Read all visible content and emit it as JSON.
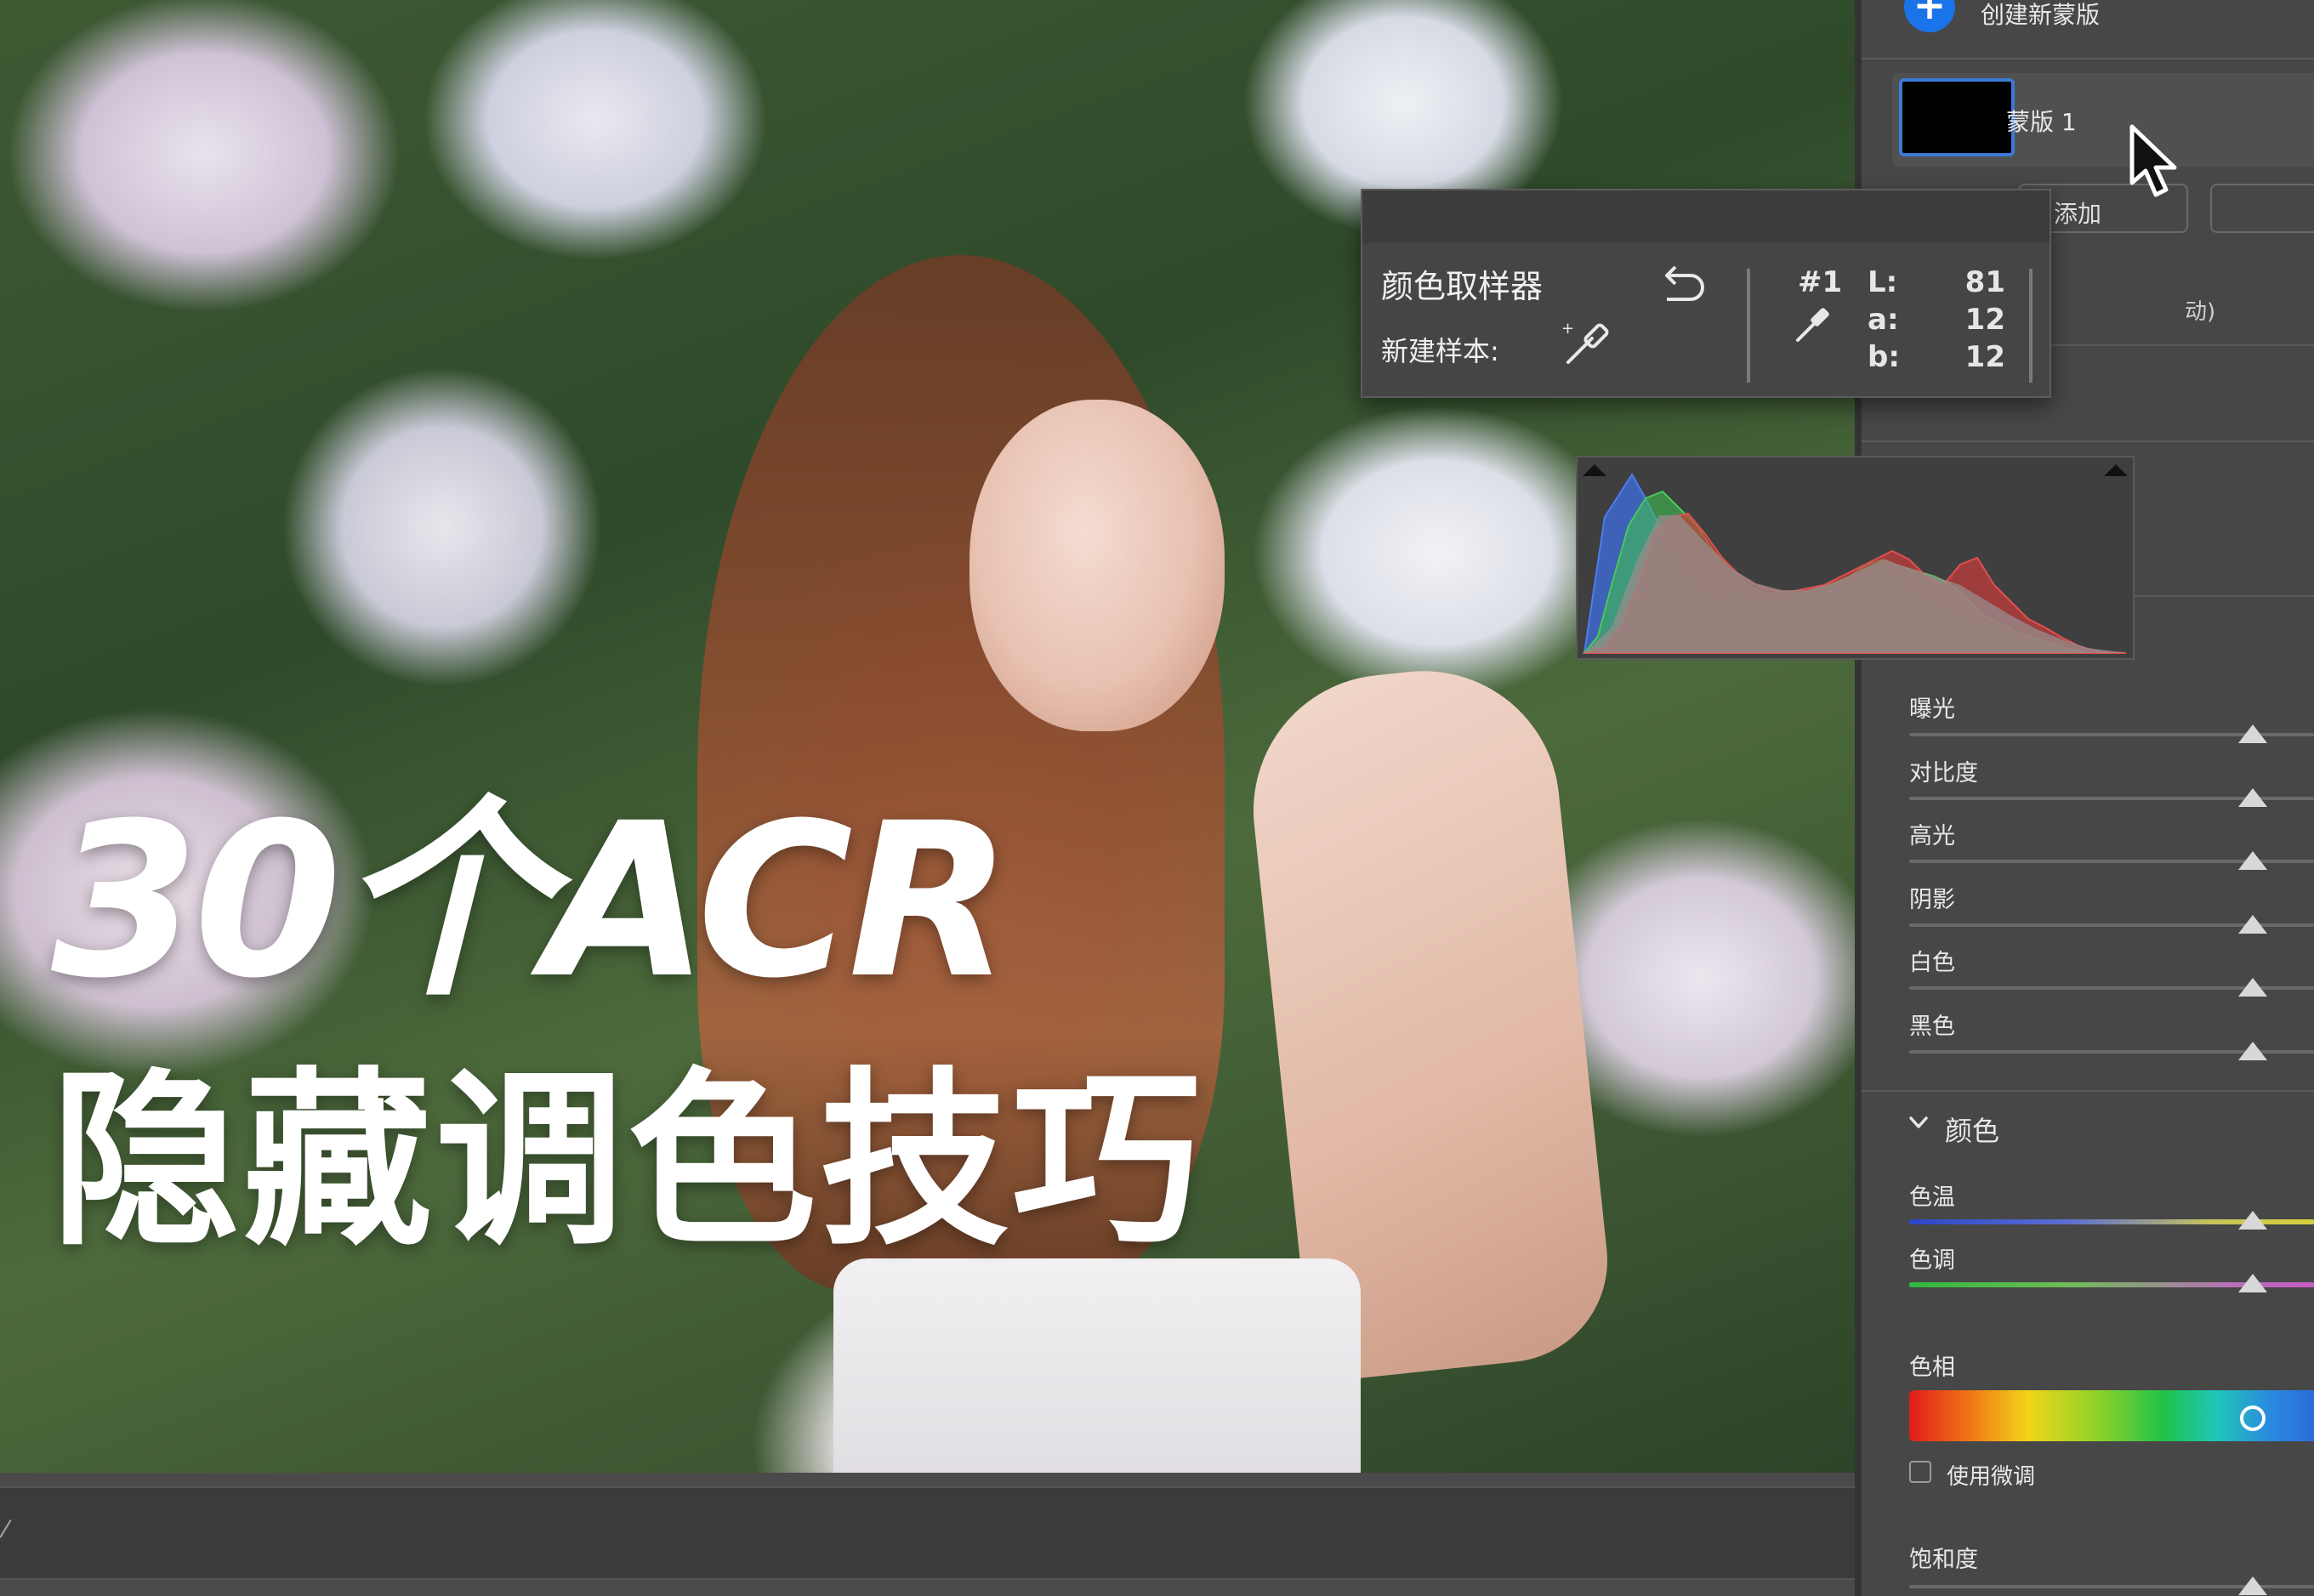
{
  "headline": {
    "line1": "30个ACR",
    "line2": "隐藏调色技巧"
  },
  "mask_panel": {
    "create_new_mask": "创建新蒙版",
    "mask_name": "蒙版 1",
    "add_button": "添加",
    "auto_suffix": "动)"
  },
  "color_sampler": {
    "title": "颜色取样器",
    "new_sample_label": "新建样本:",
    "sample_id": "#1",
    "lab": [
      {
        "key": "L:",
        "value": "81"
      },
      {
        "key": "a:",
        "value": "12"
      },
      {
        "key": "b:",
        "value": "12"
      }
    ]
  },
  "light_sliders": [
    {
      "label": "曝光",
      "value_fraction": 0.5
    },
    {
      "label": "对比度",
      "value_fraction": 0.5
    },
    {
      "label": "高光",
      "value_fraction": 0.5
    },
    {
      "label": "阴影",
      "value_fraction": 0.5
    },
    {
      "label": "白色",
      "value_fraction": 0.5
    },
    {
      "label": "黑色",
      "value_fraction": 0.5
    }
  ],
  "color_section": {
    "header": "颜色",
    "temperature": {
      "label": "色温",
      "value_fraction": 0.5
    },
    "tint": {
      "label": "色调",
      "value_fraction": 0.5
    },
    "hue_label": "色相",
    "hue_fraction": 0.5,
    "fine_tune_label": "使用微调",
    "fine_tune_checked": false,
    "saturation": {
      "label": "饱和度",
      "value_fraction": 0.5
    }
  },
  "colors": {
    "accent_blue": "#1a73e8",
    "panel_bg": "#474747",
    "histogram_red": "#d23a3a",
    "histogram_green": "#3fbf52",
    "histogram_blue": "#3d6fe0"
  }
}
